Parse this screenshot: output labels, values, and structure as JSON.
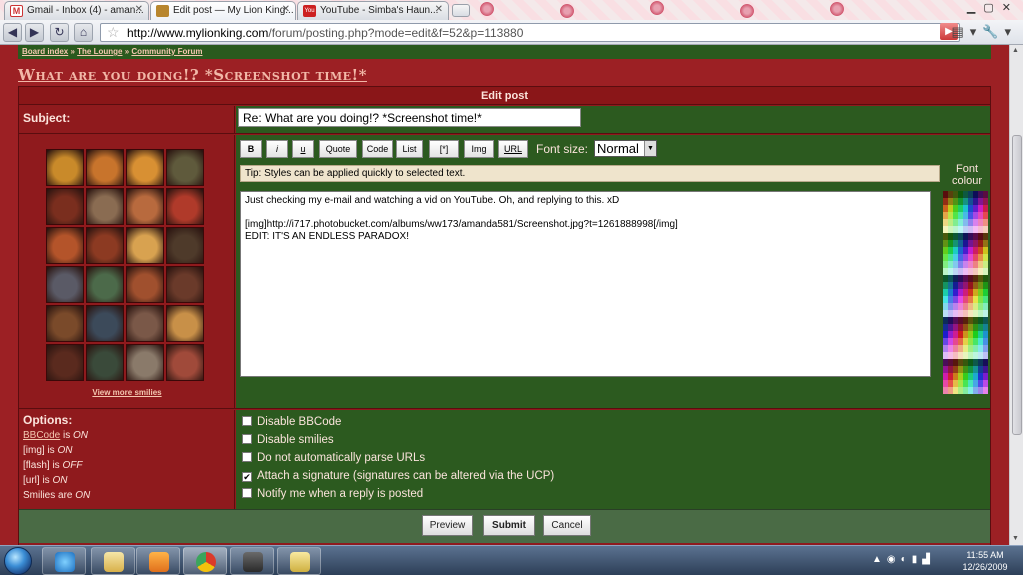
{
  "tabs": [
    {
      "label": "Gmail - Inbox (4) - aman...",
      "icon": "gmail-icon"
    },
    {
      "label": "Edit post — My Lion King...",
      "icon": "lionking-favicon"
    },
    {
      "label": "YouTube - Simba's Haun...",
      "icon": "youtube-icon"
    }
  ],
  "url": {
    "host": "http://www.mylionking.com",
    "path": "/forum/posting.php?mode=edit&f=52&p=113880"
  },
  "breadcrumb": [
    "Board index",
    "The Lounge",
    "Community Forum"
  ],
  "topic_title": "What are you doing!? *Screenshot time!*",
  "panel_title": "Edit post",
  "subject": {
    "label": "Subject:",
    "value": "Re: What are you doing!? *Screenshot time!*"
  },
  "bbcode_buttons": [
    "B",
    "i",
    "u",
    "Quote",
    "Code",
    "List",
    "[*]",
    "Img",
    "URL"
  ],
  "font_size": {
    "label": "Font size:",
    "value": "Normal"
  },
  "tip": "Tip: Styles can be applied quickly to selected text.",
  "font_colour_label": "Font colour",
  "message": "Just checking my e-mail and watching a vid on YouTube. Oh, and replying to this. xD\n\n[img]http://i717.photobucket.com/albums/ww173/amanda581/Screenshot.jpg?t=1261888998[/img]\nEDIT: IT'S AN ENDLESS PARADOX!",
  "view_more_smilies": "View more smilies",
  "smiley_colors": [
    "#c98a2a",
    "#c8742c",
    "#d89033",
    "#5f5a3c",
    "#7a2e1e",
    "#8a6c52",
    "#b86a3e",
    "#b03a2a",
    "#b4542a",
    "#8c3a22",
    "#d8a250",
    "#4e3a2a",
    "#5a5a66",
    "#4c6a4a",
    "#a0502e",
    "#6a3a2a",
    "#7a4a2a",
    "#3c4a5a",
    "#7a5848",
    "#c89048",
    "#5a2a1e",
    "#3a4a3a",
    "#8a7a6a",
    "#a04a3a"
  ],
  "options": {
    "title": "Options:",
    "lines": [
      {
        "link": "BBCode",
        "text": " is ",
        "state": "ON"
      },
      {
        "link": "",
        "text": "[img] is ",
        "state": "ON"
      },
      {
        "link": "",
        "text": "[flash] is ",
        "state": "OFF"
      },
      {
        "link": "",
        "text": "[url] is ",
        "state": "ON"
      },
      {
        "link": "",
        "text": "Smilies are ",
        "state": "ON"
      }
    ]
  },
  "checkboxes": [
    {
      "label": "Disable BBCode",
      "checked": false
    },
    {
      "label": "Disable smilies",
      "checked": false
    },
    {
      "label": "Do not automatically parse URLs",
      "checked": false
    },
    {
      "label": "Attach a signature (signatures can be altered via the UCP)",
      "checked": true
    },
    {
      "label": "Notify me when a reply is posted",
      "checked": false
    }
  ],
  "actions": {
    "preview": "Preview",
    "submit": "Submit",
    "cancel": "Cancel"
  },
  "clock": {
    "time": "11:55 AM",
    "date": "12/26/2009"
  }
}
